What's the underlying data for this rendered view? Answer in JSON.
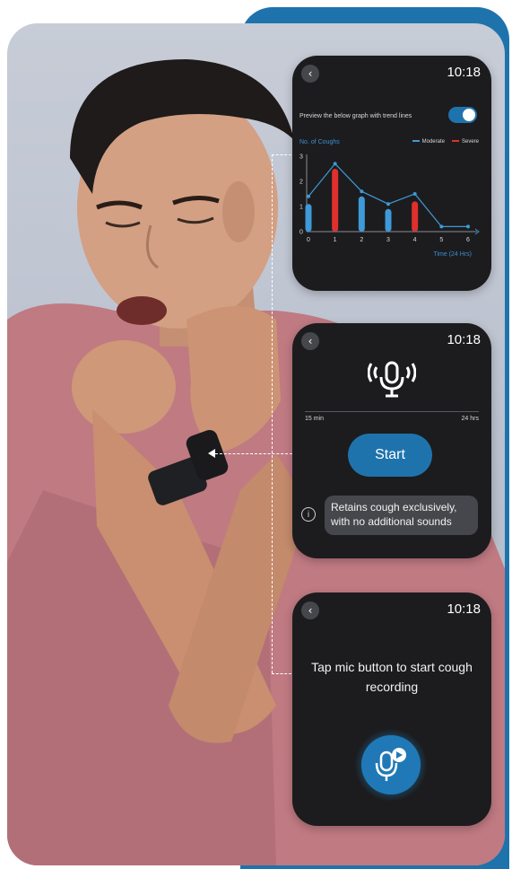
{
  "colors": {
    "accent": "#1f73ad",
    "moderate": "#3e9ad8",
    "severe": "#e0302e",
    "watch_bg": "#1c1c1e"
  },
  "screen_graph": {
    "time": "10:18",
    "toggle_label": "Preview the below graph with trend lines",
    "toggle_on": true
  },
  "chart_data": {
    "type": "bar",
    "title": "No. of Coughs",
    "xlabel": "Time (24 Hrs)",
    "categories": [
      "0",
      "1",
      "2",
      "3",
      "4",
      "5",
      "6"
    ],
    "y_ticks": [
      "0",
      "1",
      "2",
      "3"
    ],
    "ylim": [
      0,
      3
    ],
    "series": [
      {
        "name": "Moderate",
        "color": "#3e9ad8",
        "values": [
          1.1,
          null,
          1.4,
          0.9,
          null,
          null,
          null
        ]
      },
      {
        "name": "Severe",
        "color": "#e0302e",
        "values": [
          null,
          2.5,
          null,
          null,
          1.2,
          null,
          null
        ]
      }
    ],
    "trend": [
      1.4,
      2.7,
      1.6,
      1.1,
      1.5,
      0.2,
      0.2
    ]
  },
  "screen_start": {
    "time": "10:18",
    "range_min": "15 min",
    "range_max": "24 hrs",
    "start_label": "Start",
    "info_text": "Retains cough exclusively, with no additional sounds"
  },
  "screen_record": {
    "time": "10:18",
    "instruction": "Tap mic button to start cough recording"
  },
  "icons": {
    "back": "chevron-left-icon",
    "mic_waves": "mic-waves-icon",
    "info": "info-icon",
    "mic_play": "mic-play-icon"
  }
}
